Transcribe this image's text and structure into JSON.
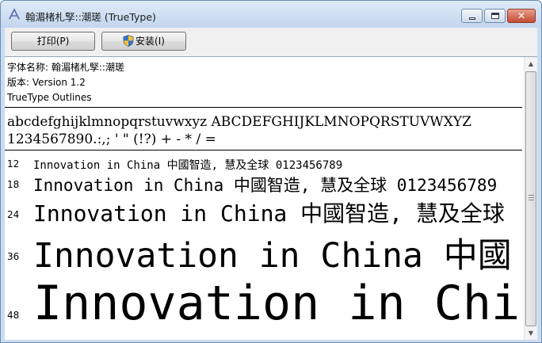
{
  "window": {
    "title": "翰湄楮札孯::潮瑳 (TrueType)",
    "close_glyph": "✕"
  },
  "toolbar": {
    "print_label": "打印(P)",
    "install_label": "安装(I)"
  },
  "font_info": {
    "name_line": "字体名称: 翰湄楮札孯::潮瑳",
    "version_line": "版本: Version 1.2",
    "outline_line": "TrueType Outlines"
  },
  "charset": {
    "letters": "abcdefghijklmnopqrstuvwxyz ABCDEFGHIJKLMNOPQRSTUVWXYZ",
    "digits_symbols": "1234567890.:,; ' \" (!?) + - * / ="
  },
  "samples": [
    {
      "size": "12",
      "text": "Innovation in China 中國智造, 慧及全球 0123456789"
    },
    {
      "size": "18",
      "text": "Innovation in China 中國智造, 慧及全球 0123456789"
    },
    {
      "size": "24",
      "text": "Innovation in China 中國智造, 慧及全球"
    },
    {
      "size": "36",
      "text": "Innovation in China 中國"
    },
    {
      "size": "48",
      "text": "Innovation in Chin"
    }
  ],
  "icons": {
    "app": "font-viewer-icon",
    "install": "uac-shield-icon",
    "scroll_up": "▲",
    "scroll_down": "▼"
  },
  "colors": {
    "title_bar": "#c2d6ee",
    "close_button": "#c44b32",
    "content_background": "#ffffff"
  }
}
